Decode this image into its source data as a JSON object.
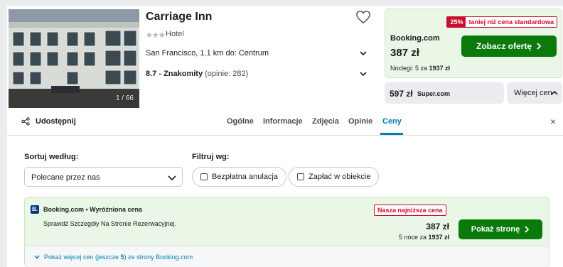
{
  "hotel": {
    "name": "Carriage Inn",
    "stars": "★★★",
    "type": "Hotel",
    "image_counter": "1 / 66",
    "location": "San Francisco, 1,1 km do: Centrum",
    "rating_score": "8.7 - Znakomity",
    "rating_count": "(opinie: 282)"
  },
  "top_deal": {
    "discount_pct": "25%",
    "discount_text": "taniej niż cena standardowa",
    "provider": "Booking.com",
    "price": "387 zł",
    "nights_text": "Noclegi: 5 za ",
    "nights_total": "1937 zł",
    "cta": "Zobacz ofertę"
  },
  "alt_deal": {
    "price": "597 zł",
    "provider": "Super.com",
    "more_label": "Więcej cen"
  },
  "tabs": {
    "share": "Udostępnij",
    "items": [
      "Ogólne",
      "Informacje",
      "Zdjęcia",
      "Opinie",
      "Ceny"
    ],
    "active": "Ceny",
    "close": "×"
  },
  "filters": {
    "sort_label": "Sortuj według:",
    "sort_value": "Polecane przez nas",
    "filter_label": "Filtruj wg:",
    "chip_free_cancel": "Bezpłatna anulacja",
    "chip_pay_at_hotel": "Zapłać w obiekcie"
  },
  "offer": {
    "logo_letter": "B.",
    "title": "Booking.com • Wyróżniona cena",
    "description": "Sprawdź Szczegóły Na Stronie Rezerwacyjnej.",
    "lowest_badge": "Nasza najniższa cena",
    "price": "387 zł",
    "nights_text": "5 noce za ",
    "nights_total": "1937 zł",
    "cta": "Pokaż stronę",
    "show_more_a": "Pokaż więcej cen (jeszcze ",
    "show_more_count": "5",
    "show_more_b": ") ze strony Booking.com"
  },
  "colors": {
    "accent": "#007fad",
    "cta_green": "#0a7a0a",
    "deal_bg": "#eaf6e6",
    "badge_red": "#c8102e"
  }
}
